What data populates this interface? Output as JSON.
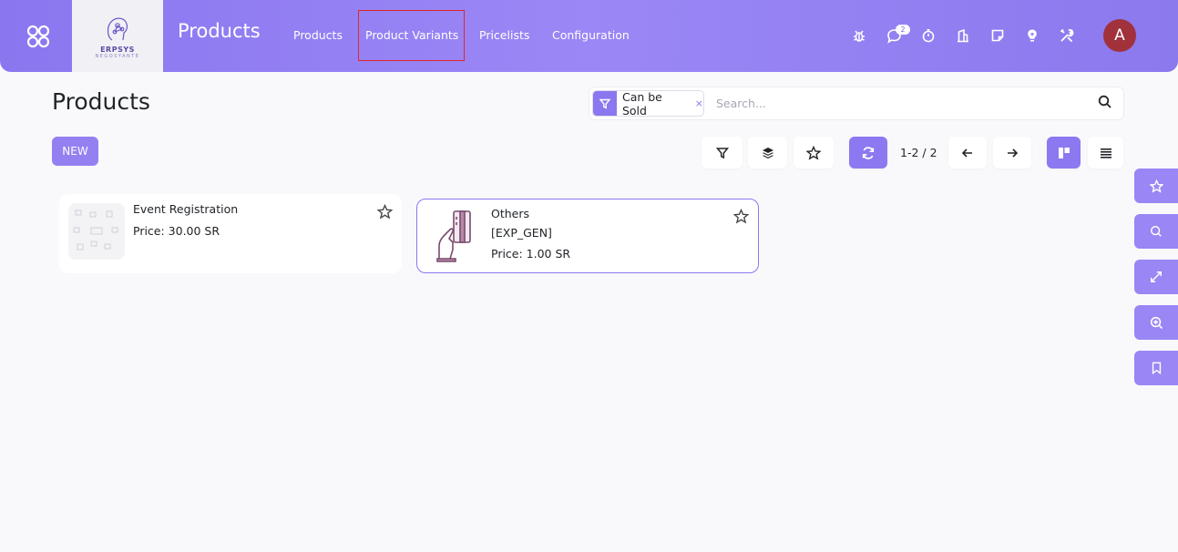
{
  "navbar": {
    "app_title": "Products",
    "logo_text": "ERPSYS",
    "logo_sub": "NEGOSYANTE",
    "menu": [
      {
        "label": "Products"
      },
      {
        "label": "Product Variants"
      },
      {
        "label": "Pricelists"
      },
      {
        "label": "Configuration"
      }
    ],
    "messages_badge": "2",
    "avatar_initial": "A"
  },
  "control_panel": {
    "title": "Products",
    "new_label": "NEW",
    "facet_label": "Can be Sold",
    "facet_remove": "×",
    "search_placeholder": "Search...",
    "pager": "1-2 / 2"
  },
  "records": [
    {
      "name": "Event Registration",
      "code": "",
      "price": "Price: 30.00 SR"
    },
    {
      "name": "Others",
      "code": "[EXP_GEN]",
      "price": "Price: 1.00 SR"
    }
  ],
  "colors": {
    "accent": "#8b77ef",
    "navbar": "#9b87f5",
    "avatar": "#a1323b",
    "highlight": "#e0262b"
  }
}
